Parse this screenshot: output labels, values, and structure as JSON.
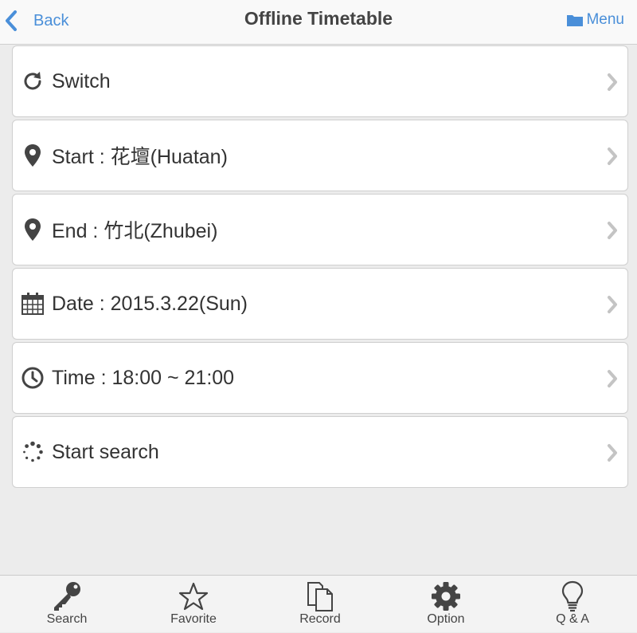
{
  "header": {
    "back_label": "Back",
    "title": "Offline Timetable",
    "menu_label": "Menu"
  },
  "items": [
    {
      "label": "Switch",
      "icon": "refresh-icon"
    },
    {
      "label": "Start : 花壇(Huatan)",
      "icon": "map-pin-icon"
    },
    {
      "label": "End : 竹北(Zhubei)",
      "icon": "map-pin-icon"
    },
    {
      "label": "Date : 2015.3.22(Sun)",
      "icon": "calendar-icon"
    },
    {
      "label": "Time : 18:00 ~ 21:00",
      "icon": "clock-icon"
    },
    {
      "label": "Start search",
      "icon": "spinner-icon"
    }
  ],
  "tabs": [
    {
      "label": "Search",
      "icon": "key-icon"
    },
    {
      "label": "Favorite",
      "icon": "star-icon"
    },
    {
      "label": "Record",
      "icon": "documents-icon"
    },
    {
      "label": "Option",
      "icon": "gear-icon"
    },
    {
      "label": "Q & A",
      "icon": "lightbulb-icon"
    }
  ],
  "colors": {
    "accent": "#4a8fd9",
    "icon": "#444444",
    "chevron": "#c4c4c4",
    "background": "#ececec"
  }
}
